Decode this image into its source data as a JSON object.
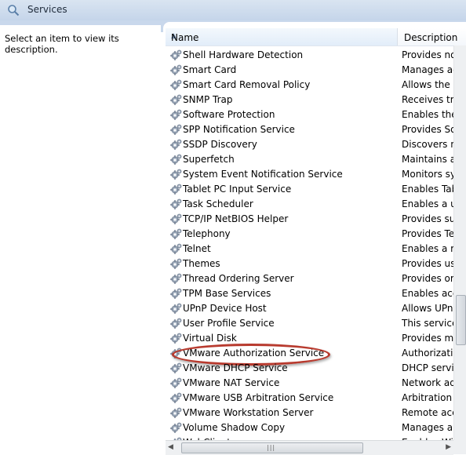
{
  "window": {
    "title": "Services",
    "icon": "search-icon"
  },
  "description_pane": {
    "text": "Select an item to view its description."
  },
  "columns": {
    "name": "Name",
    "description": "Description"
  },
  "services": [
    {
      "name": "Shell Hardware Detection",
      "description": "Provides no..."
    },
    {
      "name": "Smart Card",
      "description": "Manages ac..."
    },
    {
      "name": "Smart Card Removal Policy",
      "description": "Allows the s..."
    },
    {
      "name": "SNMP Trap",
      "description": "Receives tra..."
    },
    {
      "name": "Software Protection",
      "description": "Enables the ..."
    },
    {
      "name": "SPP Notification Service",
      "description": "Provides So..."
    },
    {
      "name": "SSDP Discovery",
      "description": "Discovers n..."
    },
    {
      "name": "Superfetch",
      "description": "Maintains a..."
    },
    {
      "name": "System Event Notification Service",
      "description": "Monitors sy..."
    },
    {
      "name": "Tablet PC Input Service",
      "description": "Enables Tab..."
    },
    {
      "name": "Task Scheduler",
      "description": "Enables a us..."
    },
    {
      "name": "TCP/IP NetBIOS Helper",
      "description": "Provides su..."
    },
    {
      "name": "Telephony",
      "description": "Provides Tel..."
    },
    {
      "name": "Telnet",
      "description": "Enables a re..."
    },
    {
      "name": "Themes",
      "description": "Provides us..."
    },
    {
      "name": "Thread Ordering Server",
      "description": "Provides or..."
    },
    {
      "name": "TPM Base Services",
      "description": "Enables acc..."
    },
    {
      "name": "UPnP Device Host",
      "description": "Allows UPn..."
    },
    {
      "name": "User Profile Service",
      "description": "This service ..."
    },
    {
      "name": "Virtual Disk",
      "description": "Provides m..."
    },
    {
      "name": "VMware Authorization Service",
      "description": "Authorizati..."
    },
    {
      "name": "VMware DHCP Service",
      "description": "DHCP servi..."
    },
    {
      "name": "VMware NAT Service",
      "description": "Network ad..."
    },
    {
      "name": "VMware USB Arbitration Service",
      "description": "Arbitration ..."
    },
    {
      "name": "VMware Workstation Server",
      "description": "Remote acc..."
    },
    {
      "name": "Volume Shadow Copy",
      "description": "Manages an..."
    },
    {
      "name": "WebClient",
      "description": "Enables Wi..."
    }
  ],
  "highlighted_service": "VMware Authorization Service",
  "colors": {
    "highlight_ellipse": "#b83a2e",
    "header_bg": "#c5d5ea"
  }
}
